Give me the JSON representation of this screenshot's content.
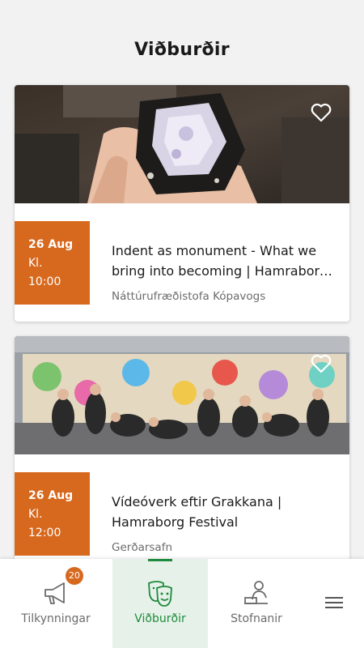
{
  "header": {
    "title": "Viðburðir"
  },
  "events": [
    {
      "date": "26 Aug",
      "kl": "Kl.",
      "time": "10:00",
      "title": "Indent as monument - What we bring into becoming | Hamraborg Festival",
      "venue": "Náttúrufræðistofa Kópavogs",
      "favorite_icon": "heart-outline-icon"
    },
    {
      "date": "26 Aug",
      "kl": "Kl.",
      "time": "12:00",
      "title": "Vídeóverk eftir Grakkana | Hamraborg Festival",
      "venue": "Gerðarsafn",
      "favorite_icon": "heart-outline-icon"
    }
  ],
  "tabbar": {
    "tabs": [
      {
        "label": "Tilkynningar",
        "icon": "megaphone-icon",
        "badge": "20"
      },
      {
        "label": "Viðburðir",
        "icon": "theater-masks-icon",
        "active": true
      },
      {
        "label": "Stofnanir",
        "icon": "institution-icon"
      }
    ],
    "menu_icon": "hamburger-menu-icon"
  },
  "colors": {
    "accent": "#d7691f",
    "active_tab": "#1f8a3d",
    "active_tab_bg": "#e6f2e9"
  }
}
